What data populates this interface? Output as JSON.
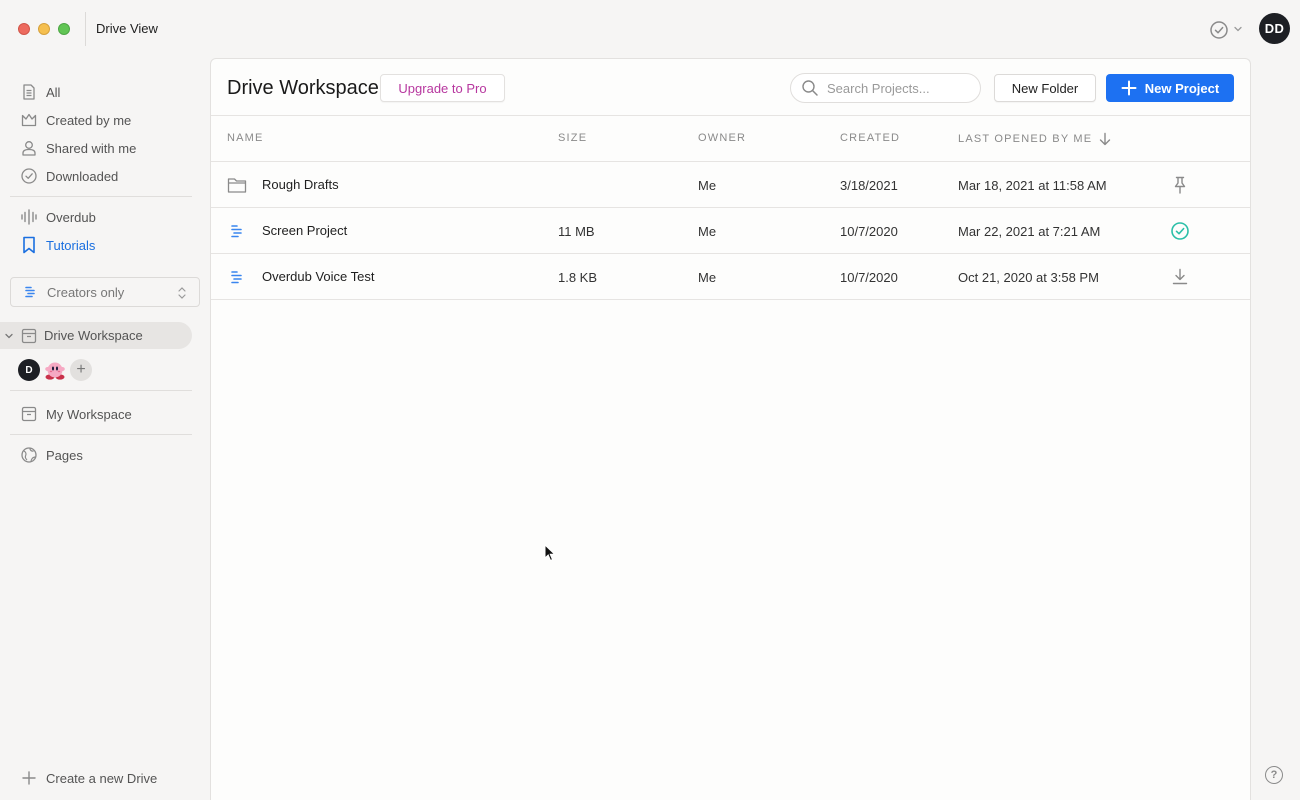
{
  "window": {
    "title": "Drive View",
    "avatar_initials": "DD"
  },
  "sidebar": {
    "items": [
      {
        "label": "All",
        "icon": "document-icon"
      },
      {
        "label": "Created by me",
        "icon": "crown-icon"
      },
      {
        "label": "Shared with me",
        "icon": "person-icon"
      },
      {
        "label": "Downloaded",
        "icon": "check-circle-icon"
      }
    ],
    "secondary": [
      {
        "label": "Overdub",
        "icon": "waveform-icon"
      },
      {
        "label": "Tutorials",
        "icon": "bookmark-icon",
        "active": true
      }
    ],
    "filter": {
      "value": "Creators only"
    },
    "drive": {
      "label": "Drive Workspace"
    },
    "members": {
      "first_initial": "D"
    },
    "my_workspace": "My Workspace",
    "pages": "Pages",
    "create_drive": "Create a new Drive"
  },
  "main": {
    "title": "Drive Workspace",
    "upgrade_label": "Upgrade to Pro",
    "search_placeholder": "Search Projects...",
    "new_folder_label": "New Folder",
    "new_project_label": "New Project",
    "columns": {
      "name": "NAME",
      "size": "SIZE",
      "owner": "OWNER",
      "created": "CREATED",
      "last_opened": "LAST OPENED BY ME"
    },
    "rows": [
      {
        "name": "Rough Drafts",
        "type": "folder",
        "size": "",
        "owner": "Me",
        "created": "3/18/2021",
        "last_opened": "Mar 18, 2021 at 11:58 AM",
        "status_icon": "pin-icon"
      },
      {
        "name": "Screen Project",
        "type": "project",
        "size": "11 MB",
        "owner": "Me",
        "created": "10/7/2020",
        "last_opened": "Mar 22, 2021 at 7:21 AM",
        "status_icon": "synced-check-icon"
      },
      {
        "name": "Overdub Voice Test",
        "type": "project",
        "size": "1.8 KB",
        "owner": "Me",
        "created": "10/7/2020",
        "last_opened": "Oct 21, 2020 at 3:58 PM",
        "status_icon": "download-icon"
      }
    ]
  },
  "colors": {
    "accent": "#1d71f2",
    "upgrade": "#b7379f",
    "active_nav": "#1a6fe0",
    "synced": "#2bbfa8"
  },
  "help_label": "?"
}
